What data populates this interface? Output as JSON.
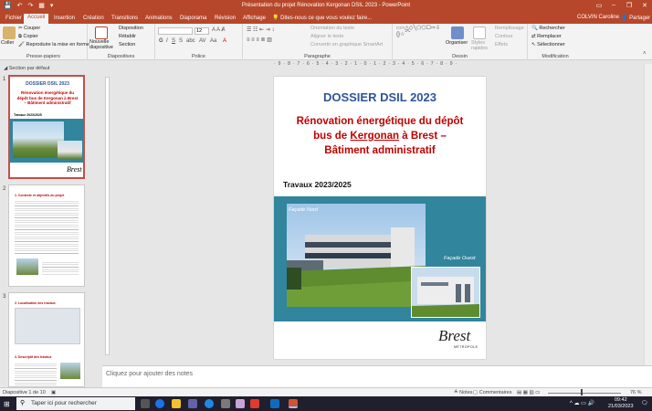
{
  "window": {
    "title": "Présentation du projet Rénovation Kergonan DSIL 2023 - PowerPoint",
    "qat_icons": "💾 ↶ ↷ ▦ ▾"
  },
  "tabs": [
    "Fichier",
    "Accueil",
    "Insertion",
    "Création",
    "Transitions",
    "Animations",
    "Diaporama",
    "Révision",
    "Affichage"
  ],
  "tell_me": "Dites-nous ce que vous voulez faire...",
  "user": "COLVIN Caroline",
  "share": "Partager",
  "ribbon": {
    "clipboard": {
      "paste": "Coller",
      "cut": "Couper",
      "copy": "Copier",
      "format_painter": "Reproduire la mise en forme",
      "label": "Presse-papiers"
    },
    "slides": {
      "new_slide": "Nouvelle diapositive",
      "layout": "Disposition",
      "reset": "Rétablir",
      "section": "Section",
      "label": "Diapositives"
    },
    "font": {
      "size": "12",
      "label": "Police"
    },
    "paragraph": {
      "text_direction": "Orientation du texte",
      "align_text": "Aligner le texte",
      "smartart": "Convertir en graphique SmartArt",
      "label": "Paragraphe"
    },
    "drawing": {
      "arrange": "Organiser",
      "quick_styles": "Styles rapides",
      "fill": "Remplissage",
      "outline": "Contour",
      "effects": "Effets",
      "label": "Dessin"
    },
    "editing": {
      "find": "Rechercher",
      "replace": "Remplacer",
      "select": "Sélectionner",
      "label": "Modification"
    }
  },
  "ruler": "·9·8·7·6·5·4·3·2·1·0·1·2·3·4·5·6·7·8·9·",
  "slides_panel": {
    "section": "Section par défaut",
    "numbers": [
      "1",
      "2",
      "3"
    ],
    "thumb1": {
      "title": "DOSSIER DSIL 2023",
      "sub": "Rénovation énergétique du dépôt bus de Kergonan à Brest – Bâtiment administratif",
      "works": "Travaux 2023/2025"
    },
    "thumb2": {
      "heading": "1. Contexte et objectifs du projet"
    },
    "thumb3": {
      "heading1": "2. Localisation des travaux",
      "heading2": "3. Descriptif des travaux"
    }
  },
  "slide": {
    "title": "DOSSIER DSIL 2023",
    "line1": "Rénovation énergétique du dépôt",
    "line2_pre": "bus de ",
    "line2_u": "Kergonan",
    "line2_post": " à Brest –",
    "line3": "Bâtiment administratif",
    "works": "Travaux 2023/2025",
    "cap_north": "Façade Nord",
    "cap_west": "Façade Ouest",
    "logo": "Brest",
    "logo_sub": "MÉTROPOLE"
  },
  "notes_placeholder": "Cliquez pour ajouter des notes",
  "status": {
    "slide_info": "Diapositive 1 de 10",
    "notes": "Notes",
    "comments": "Commentaires",
    "zoom": "76 %"
  },
  "taskbar": {
    "search": "Taper ici pour rechercher",
    "time": "09:42",
    "date": "21/03/2023"
  },
  "colors": {
    "accent": "#b7472a",
    "title_blue": "#2f5597",
    "title_red": "#c00000",
    "band": "#31859c"
  }
}
